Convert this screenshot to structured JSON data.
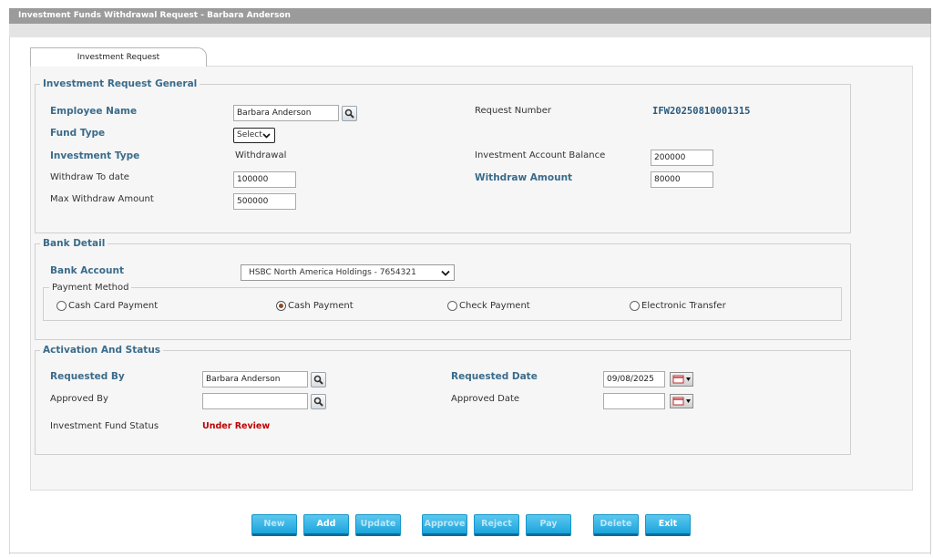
{
  "window": {
    "title": "Investment Funds Withdrawal Request  - Barbara Anderson"
  },
  "tabs": [
    {
      "label": "Investment Request"
    }
  ],
  "general": {
    "legend": "Investment Request General",
    "employee_name_label": "Employee Name",
    "employee_name_value": "Barbara Anderson",
    "fund_type_label": "Fund Type",
    "fund_type_value": "Select",
    "investment_type_label": "Investment Type",
    "investment_type_value": "Withdrawal",
    "withdraw_to_date_label": "Withdraw To date",
    "withdraw_to_date_value": "100000",
    "max_withdraw_label": "Max Withdraw Amount",
    "max_withdraw_value": "500000",
    "request_number_label": "Request Number",
    "request_number_value": "IFW20250810001315",
    "account_balance_label": "Investment Account Balance",
    "account_balance_value": "200000",
    "withdraw_amount_label": "Withdraw Amount",
    "withdraw_amount_value": "80000"
  },
  "bank": {
    "legend": "Bank Detail",
    "account_label": "Bank Account",
    "account_value": "HSBC North America Holdings - 7654321",
    "payment_legend": "Payment Method",
    "methods": [
      {
        "label": "Cash Card Payment",
        "selected": false
      },
      {
        "label": "Cash Payment",
        "selected": true
      },
      {
        "label": "Check Payment",
        "selected": false
      },
      {
        "label": "Electronic Transfer",
        "selected": false
      }
    ]
  },
  "activation": {
    "legend": "Activation And Status",
    "requested_by_label": "Requested By",
    "requested_by_value": "Barbara Anderson",
    "approved_by_label": "Approved By",
    "approved_by_value": "",
    "status_label": "Investment Fund Status",
    "status_value": "Under Review",
    "requested_date_label": "Requested Date",
    "requested_date_value": "09/08/2025",
    "approved_date_label": "Approved Date",
    "approved_date_value": ""
  },
  "buttons": {
    "new": "New",
    "add": "Add",
    "update": "Update",
    "approve": "Approve",
    "reject": "Reject",
    "pay": "Pay",
    "delete": "Delete",
    "exit": "Exit"
  },
  "colors": {
    "accent_label": "#3a6b8a",
    "status": "#c00000",
    "button": "#1aa4dc"
  }
}
